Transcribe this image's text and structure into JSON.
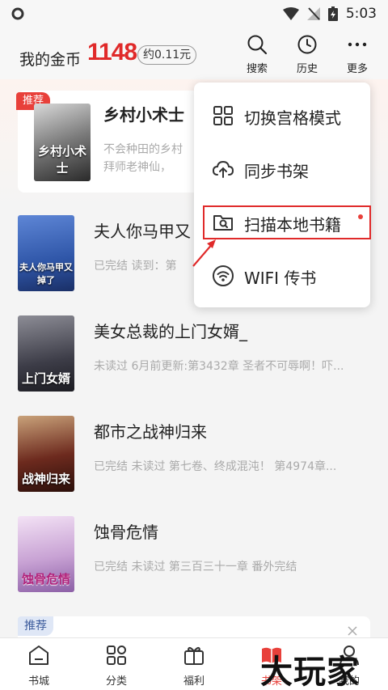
{
  "status_bar": {
    "time": "5:03"
  },
  "header": {
    "coin_label": "我的金币",
    "coin_value": "1148",
    "coin_approx": "约0.11元",
    "search_label": "搜索",
    "history_label": "历史",
    "more_label": "更多"
  },
  "recommend_card": {
    "badge": "推荐",
    "title": "乡村小术士",
    "cover_text": "乡村小术士",
    "desc_line1": "不会种田的乡村",
    "desc_line2": "拜师老神仙，"
  },
  "books": [
    {
      "title": "夫人你马甲又",
      "meta": "已完结 读到：第",
      "cover_text": "夫人你马甲又掉了",
      "cover_color": "#2f56a8"
    },
    {
      "title": "美女总裁的上门女婿_",
      "meta": "未读过 6月前更新:第3432章 圣者不可辱啊！吓...",
      "cover_text": "上门女婿",
      "cover_color": "#3d3d48"
    },
    {
      "title": "都市之战神归来",
      "meta": "已完结 未读过 第七卷、终成混沌！ 第4974章...",
      "cover_text": "战神归来",
      "cover_color": "#6d2a1e"
    },
    {
      "title": "蚀骨危情",
      "meta": "已完结 未读过 第三百三十一章 番外完结",
      "cover_text": "蚀骨危情",
      "cover_color": "#c8a2d4"
    }
  ],
  "bottom_recommend": {
    "badge": "推荐"
  },
  "menu": {
    "items": [
      {
        "label": "切换宫格模式",
        "icon": "grid-icon"
      },
      {
        "label": "同步书架",
        "icon": "cloud-upload-icon"
      },
      {
        "label": "扫描本地书籍",
        "icon": "folder-scan-icon"
      },
      {
        "label": "WIFI 传书",
        "icon": "wifi-icon"
      }
    ]
  },
  "bottom_nav": {
    "items": [
      {
        "label": "书城",
        "icon": "store-icon"
      },
      {
        "label": "分类",
        "icon": "category-icon"
      },
      {
        "label": "福利",
        "icon": "gift-icon"
      },
      {
        "label": "书架",
        "icon": "bookshelf-icon"
      },
      {
        "label": "我的",
        "icon": "profile-icon"
      }
    ]
  },
  "watermark": "大玩家",
  "colors": {
    "accent_red": "#e8403a",
    "coin_red": "#e02a2a",
    "highlight_border": "#e02a2a"
  }
}
